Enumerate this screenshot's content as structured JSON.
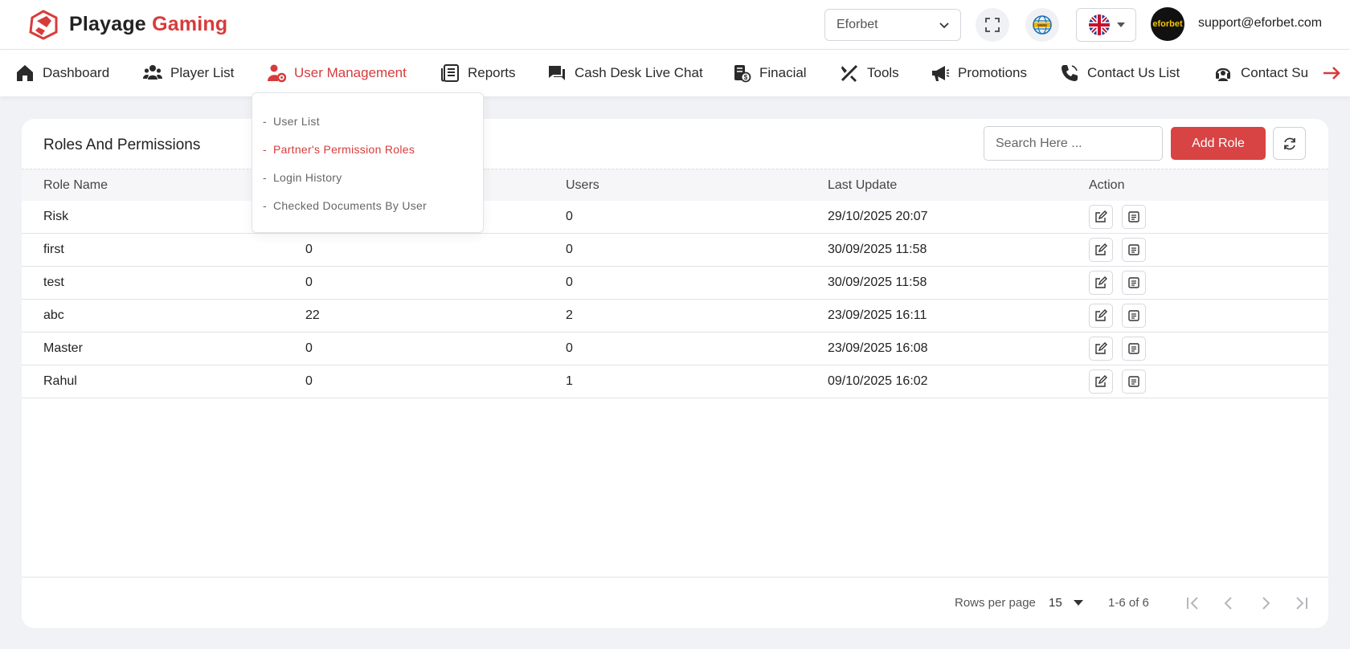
{
  "header": {
    "logo_main": "Playage",
    "logo_accent": "Gaming",
    "brand_select": "Eforbet",
    "avatar_text": "eforbet",
    "support_email": "support@eforbet.com"
  },
  "nav": {
    "items": [
      {
        "label": "Dashboard",
        "icon": "home-icon"
      },
      {
        "label": "Player List",
        "icon": "users-icon"
      },
      {
        "label": "User Management",
        "icon": "user-gear-icon"
      },
      {
        "label": "Reports",
        "icon": "report-icon"
      },
      {
        "label": "Cash Desk Live Chat",
        "icon": "chat-icon"
      },
      {
        "label": "Finacial",
        "icon": "money-check-icon"
      },
      {
        "label": "Tools",
        "icon": "tools-icon"
      },
      {
        "label": "Promotions",
        "icon": "megaphone-icon"
      },
      {
        "label": "Contact Us List",
        "icon": "phone-icon"
      },
      {
        "label": "Contact Su",
        "icon": "headset-icon"
      }
    ],
    "active_index": 2
  },
  "dropdown": {
    "items": [
      "User List",
      "Partner's Permission Roles",
      "Login History",
      "Checked Documents By User"
    ],
    "active_index": 1
  },
  "card": {
    "title": "Roles And Permissions",
    "search_placeholder": "Search Here ...",
    "add_label": "Add Role"
  },
  "table": {
    "headers": [
      "Role Name",
      "",
      "Users",
      "Last Update",
      "Action"
    ],
    "rows": [
      [
        "Risk",
        "",
        "0",
        "29/10/2025 20:07"
      ],
      [
        "first",
        "0",
        "0",
        "30/09/2025 11:58"
      ],
      [
        "test",
        "0",
        "0",
        "30/09/2025 11:58"
      ],
      [
        "abc",
        "22",
        "2",
        "23/09/2025 16:11"
      ],
      [
        "Master",
        "0",
        "0",
        "23/09/2025 16:08"
      ],
      [
        "Rahul",
        "0",
        "1",
        "09/10/2025 16:02"
      ]
    ]
  },
  "pagination": {
    "rows_per_page_label": "Rows per page",
    "rows_per_page": "15",
    "range": "1-6 of 6"
  },
  "colors": {
    "accent": "#d83b3b",
    "background": "#f1f2f6"
  }
}
